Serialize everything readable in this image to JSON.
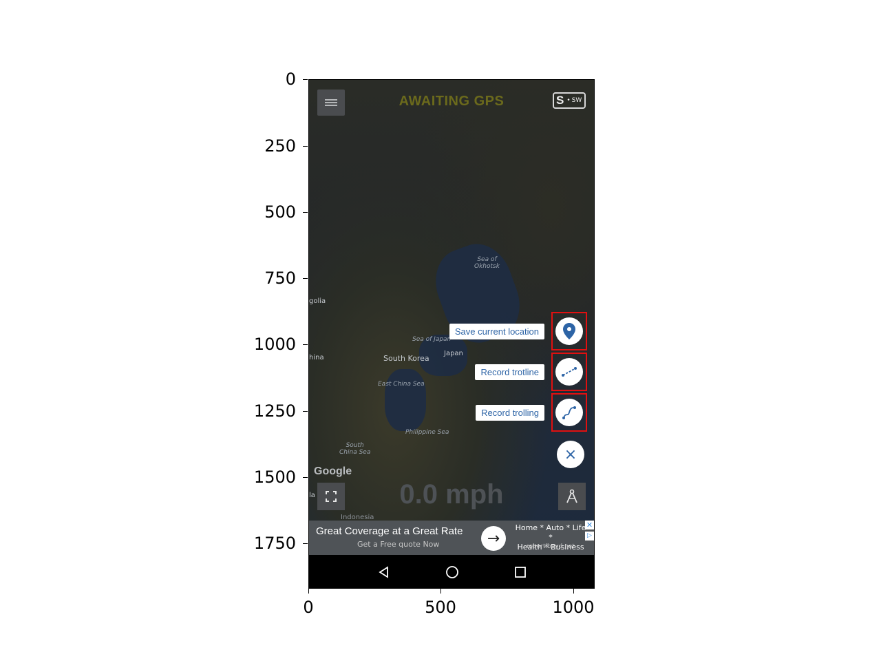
{
  "axes": {
    "y_ticks": [
      "0",
      "250",
      "500",
      "750",
      "1000",
      "1250",
      "1500",
      "1750"
    ],
    "x_ticks": [
      "0",
      "500",
      "1000"
    ]
  },
  "app": {
    "status_title": "AWAITING GPS",
    "compass": {
      "big_letter": "S",
      "direction": "SW"
    },
    "speed": "0.0 mph",
    "google_logo": "Google"
  },
  "map": {
    "labels": {
      "sea_okhotsk": "Sea of\nOkhotsk",
      "mongolia": "golia",
      "sea_japan": "Sea of Japan",
      "japan": "Japan",
      "china": "hina",
      "south_korea": "South Korea",
      "east_china_sea": "East China Sea",
      "philippine_sea": "Philippine Sea",
      "south_china_sea": "South\nChina Sea",
      "indonesia": "Indonesia",
      "laos": "la"
    }
  },
  "actions": [
    {
      "label": "Save current location",
      "icon": "location-pin-icon"
    },
    {
      "label": "Record trotline",
      "icon": "trotline-icon"
    },
    {
      "label": "Record trolling",
      "icon": "trolling-path-icon"
    }
  ],
  "close_label": "×",
  "ad": {
    "title": "Great Coverage at a Great Rate",
    "subtitle": "Get a Free quote Now",
    "right_line1": "Home * Auto * Life *",
    "right_line2": "Health * Business",
    "url": "robertlboyd.net",
    "close": "✕",
    "info": "▷"
  },
  "colors": {
    "accent_blue": "#2d64a6",
    "highlight_red": "#e01010",
    "title_olive": "#6b6a1c"
  }
}
